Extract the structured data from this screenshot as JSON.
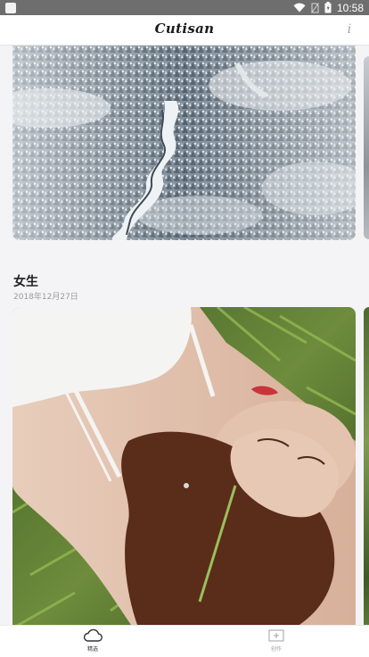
{
  "status_bar": {
    "time": "10:58",
    "icons": [
      "app-square-icon",
      "wifi-icon",
      "no-sim-icon",
      "battery-icon"
    ]
  },
  "header": {
    "logo_text": "Cutisan",
    "info_label": "i"
  },
  "feed": {
    "sections": [
      {
        "title": "女生",
        "date": "2018年12月27日",
        "image": "woman-lying-in-grass-photo"
      }
    ],
    "previous_image": "snowy-forest-river-photo"
  },
  "tab_bar": {
    "tabs": [
      {
        "label": "精选",
        "icon": "cloud-icon",
        "active": true
      },
      {
        "label": "创作",
        "icon": "add-frame-icon",
        "active": false
      }
    ]
  },
  "colors": {
    "status_bar": "#6e6e6e",
    "header_bg": "#ffffff",
    "page_bg": "#f4f4f6",
    "active_tab": "#333333",
    "inactive_tab": "#a0a0a0"
  }
}
